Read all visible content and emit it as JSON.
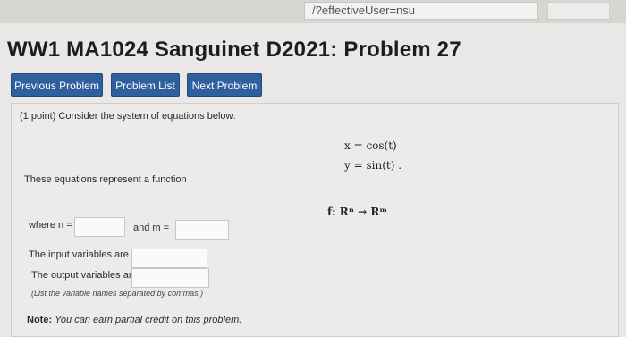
{
  "browser": {
    "url_fragment": "/?effectiveUser=nsu"
  },
  "page": {
    "title": "WW1 MA1024 Sanguinet D2021: Problem 27"
  },
  "nav": {
    "previous_label": "Previous Problem",
    "list_label": "Problem List",
    "next_label": "Next Problem"
  },
  "problem": {
    "intro": "(1 point) Consider the system of equations below:",
    "eq1": "x = cos(t)",
    "eq2": "y = sin(t) .",
    "represent_text": "These equations represent a function",
    "function_text": "f: Rⁿ → Rᵐ",
    "where_label": "where n =",
    "and_label": "and m =",
    "n_value": "",
    "m_value": "",
    "input_vars_label": "The input variables are",
    "output_vars_label": "The output variables are",
    "input_vars_value": "",
    "output_vars_value": "",
    "hint": "(List the variable names separated by commas.)",
    "note_label": "Note:",
    "note_text": "You can earn partial credit on this problem."
  }
}
